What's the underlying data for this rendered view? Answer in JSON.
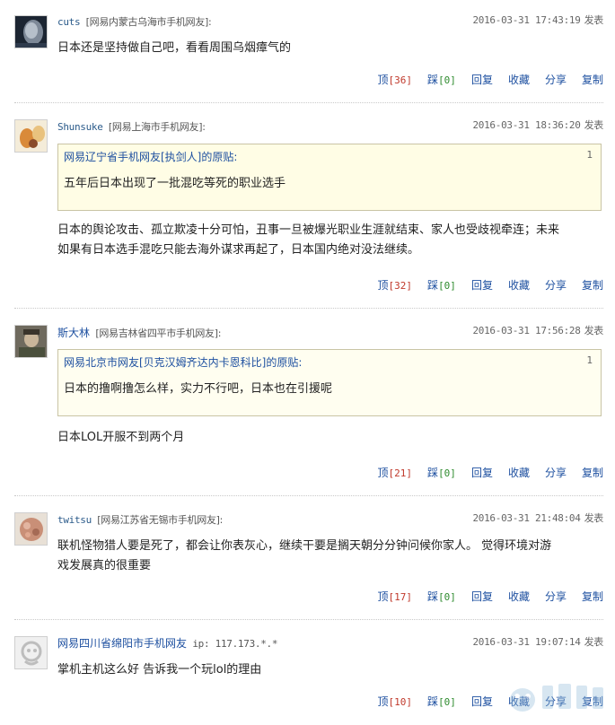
{
  "labels": {
    "publish": "发表",
    "up": "顶",
    "down": "踩",
    "reply": "回复",
    "collect": "收藏",
    "share": "分享",
    "copy": "复制"
  },
  "comments": [
    {
      "user": "cuts",
      "location": "[网易内蒙古乌海市手机网友]:",
      "time": "2016-03-31 17:43:19",
      "text": "日本还是坚持做自己吧，看看周围乌烟瘴气的",
      "up_count": "[36]",
      "down_count": "[0]"
    },
    {
      "user": "Shunsuke",
      "location": "[网易上海市手机网友]:",
      "time": "2016-03-31 18:36:20",
      "quote": {
        "header": "网易辽宁省手机网友[执剑人]的原贴:",
        "floor": "1",
        "text": "五年后日本出现了一批混吃等死的职业选手"
      },
      "text_line1": "日本的舆论攻击、孤立欺凌十分可怕，丑事一旦被爆光职业生涯就结束、家人也受歧视牵连；未来",
      "text_line2": "如果有日本选手混吃只能去海外谋求再起了，日本国内绝对没法继续。",
      "up_count": "[32]",
      "down_count": "[0]"
    },
    {
      "user": "斯大林",
      "location": "[网易吉林省四平市手机网友]:",
      "time": "2016-03-31 17:56:28",
      "quote": {
        "header": "网易北京市网友[贝克汉姆齐达内卡恩科比]的原贴:",
        "floor": "1",
        "text": "日本的撸啊撸怎么样，实力不行吧，日本也在引援呢"
      },
      "text": "日本LOL开服不到两个月",
      "up_count": "[21]",
      "down_count": "[0]"
    },
    {
      "user": "twitsu",
      "location": "[网易江苏省无锡市手机网友]:",
      "time": "2016-03-31 21:48:04",
      "text_line1": "联机怪物猎人要是死了，都会让你表灰心，继续干要是搁天朝分分钟问候你家人。 觉得环境对游",
      "text_line2": "戏发展真的很重要",
      "up_count": "[17]",
      "down_count": "[0]"
    },
    {
      "user": "网易四川省绵阳市手机网友",
      "ip_label": "ip:",
      "ip": "117.173.*.*",
      "time": "2016-03-31 19:07:14",
      "text": "掌机主机这么好 告诉我一个玩lol的理由",
      "up_count": "[10]",
      "down_count": "[0]"
    }
  ]
}
